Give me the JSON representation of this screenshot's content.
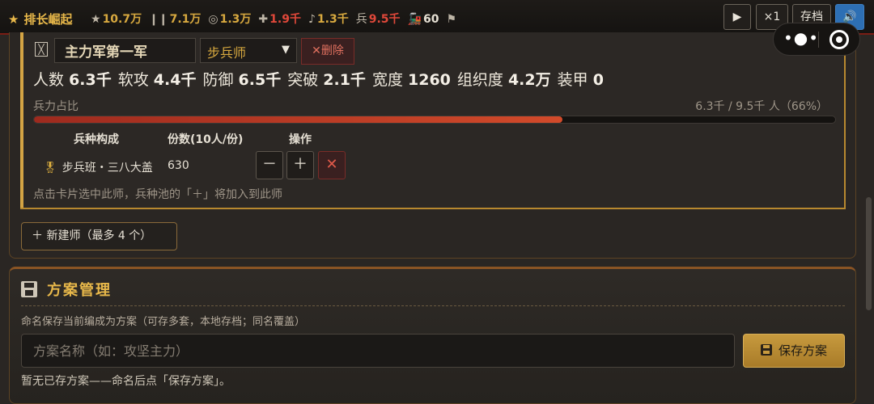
{
  "topbar": {
    "brand": "排长崛起",
    "stats": [
      {
        "icon": "★",
        "icon_name": "star-icon",
        "value": "10.7万",
        "style": "gold"
      },
      {
        "icon": "❙❙",
        "icon_name": "bars-icon",
        "value": "7.1万",
        "style": "gold"
      },
      {
        "icon": "◎",
        "icon_name": "target-icon",
        "value": "1.3万",
        "style": "gold"
      },
      {
        "icon": "✚",
        "icon_name": "plus-icon",
        "value": "1.9千",
        "style": "red"
      },
      {
        "icon": "♪",
        "icon_name": "note-icon",
        "value": "1.3千",
        "style": "gold"
      },
      {
        "icon": "兵",
        "icon_name": "soldier-icon",
        "value": "9.5千",
        "style": "red"
      },
      {
        "icon": "🚂",
        "icon_name": "train-icon",
        "value": "60",
        "style": "plain"
      },
      {
        "icon": "⚑",
        "icon_name": "flag-icon",
        "value": "",
        "style": "plain"
      }
    ],
    "play_label": "▶",
    "speed_label": "×1",
    "save_label": "存档",
    "sound_label": "🔊"
  },
  "division": {
    "name": "主力军第一军",
    "type_select": "步兵师",
    "delete_label": "删除",
    "summary": [
      {
        "label": "人数",
        "value": "6.3千"
      },
      {
        "label": "软攻",
        "value": "4.4千"
      },
      {
        "label": "防御",
        "value": "6.5千"
      },
      {
        "label": "突破",
        "value": "2.1千"
      },
      {
        "label": "宽度",
        "value": "1260"
      },
      {
        "label": "组织度",
        "value": "4.2万"
      },
      {
        "label": "装甲",
        "value": "0"
      }
    ],
    "strength_label": "兵力占比",
    "strength_value": "6.3千 / 9.5千 人（66%）",
    "strength_ratio": 0.66,
    "table_headers": {
      "composition": "兵种构成",
      "count": "份数(10人/份)",
      "ops": "操作"
    },
    "unit_row": {
      "name": "步兵班・三八大盖",
      "count": "630"
    },
    "op_minus": "－",
    "op_plus": "＋",
    "op_remove": "✕",
    "hint": "点击卡片选中此师，兵种池的「＋」将加入到此师"
  },
  "new_division_label": "＋ 新建师（最多 4 个）",
  "plan": {
    "title": "方案管理",
    "description": "命名保存当前编成为方案（可存多套，本地存档；同名覆盖）",
    "input_placeholder": "方案名称（如：攻坚主力）",
    "save_label": "保存方案",
    "empty_text": "暂无已存方案——命名后点「保存方案」。"
  }
}
